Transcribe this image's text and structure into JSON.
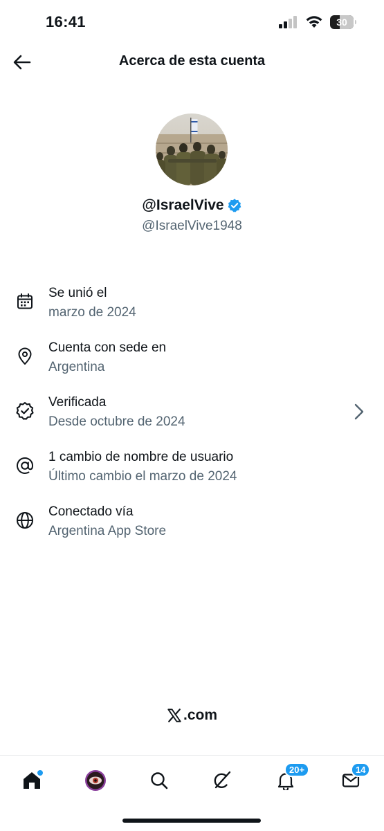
{
  "status_bar": {
    "time": "16:41",
    "battery": "30",
    "icons": [
      "signal-icon",
      "wifi-icon",
      "battery-icon"
    ]
  },
  "header": {
    "title": "Acerca de esta cuenta",
    "back_icon": "arrow-left-icon"
  },
  "profile": {
    "display_name": "@IsraelVive",
    "handle": "@IsraelVive1948",
    "verified": true,
    "verified_color": "#1d9bf0"
  },
  "info": [
    {
      "icon": "calendar-icon",
      "title": "Se unió el",
      "subtitle": "marzo de 2024"
    },
    {
      "icon": "location-pin-icon",
      "title": "Cuenta con sede en",
      "subtitle": "Argentina"
    },
    {
      "icon": "verified-badge-icon",
      "title": "Verificada",
      "subtitle": "Desde octubre de 2024",
      "has_chevron": true
    },
    {
      "icon": "at-sign-icon",
      "title": "1 cambio de nombre de usuario",
      "subtitle": "Último cambio el marzo de 2024"
    },
    {
      "icon": "globe-icon",
      "title": "Conectado vía",
      "subtitle": "Argentina App Store"
    }
  ],
  "brand": {
    "text": ".com",
    "logo": "x-logo-icon"
  },
  "bottom_nav": {
    "items": [
      {
        "name": "home",
        "icon": "home-icon",
        "has_dot": true
      },
      {
        "name": "grok",
        "icon": "profile-avatar-icon"
      },
      {
        "name": "search",
        "icon": "search-icon"
      },
      {
        "name": "grok-ai",
        "icon": "grok-icon"
      },
      {
        "name": "notifications",
        "icon": "bell-icon",
        "badge": "20+"
      },
      {
        "name": "messages",
        "icon": "mail-icon",
        "badge": "14"
      }
    ],
    "accent": "#1d9bf0"
  }
}
